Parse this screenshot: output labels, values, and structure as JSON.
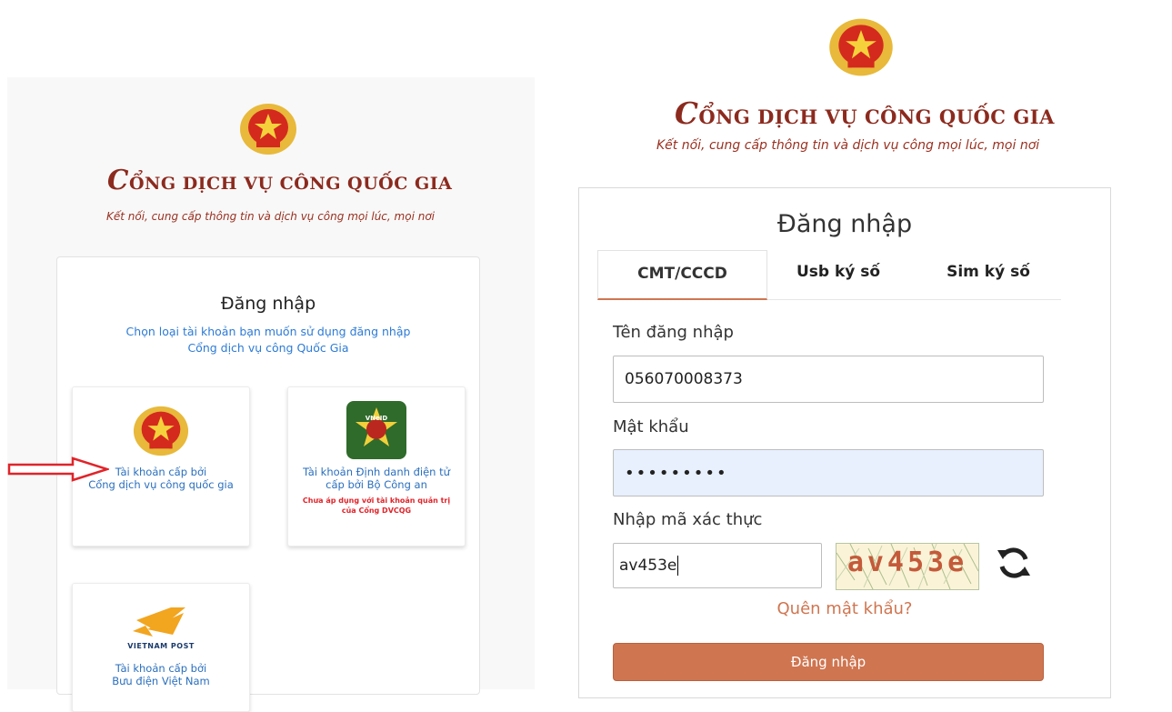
{
  "brand": {
    "title_rest": "ỔNG DỊCH VỤ CÔNG QUỐC GIA",
    "title_initial": "C",
    "tagline": "Kết nối, cung cấp thông tin và dịch vụ công mọi lúc, mọi nơi"
  },
  "left": {
    "card_title": "Đăng nhập",
    "card_sub_line1": "Chọn loại tài khoản bạn muốn sử dụng đăng nhập",
    "card_sub_line2": "Cổng dịch vụ công Quốc Gia",
    "options": [
      {
        "line1": "Tài khoản cấp bởi",
        "line2": "Cổng dịch vụ công quốc gia",
        "icon": "national-emblem-icon"
      },
      {
        "line1": "Tài khoản Định danh điện tử",
        "line2": "cấp bởi Bộ Công an",
        "warn1": "Chưa áp dụng với tài khoản quản trị",
        "warn2": "của Cổng DVCQG",
        "badge_text": "VNeID",
        "icon": "vneid-logo-icon"
      },
      {
        "line1": "Tài khoản cấp bởi",
        "line2": "Bưu điện Việt Nam",
        "logo_text": "VIETNAM POST",
        "icon": "vietnam-post-logo-icon"
      }
    ]
  },
  "login": {
    "title": "Đăng nhập",
    "tabs": [
      "CMT/CCCD",
      "Usb ký số",
      "Sim ký số"
    ],
    "username_label": "Tên đăng nhập",
    "username_value": "056070008373",
    "password_label": "Mật khẩu",
    "password_value": "•••••••••",
    "captcha_label": "Nhập mã xác thực",
    "captcha_input": "av453e",
    "captcha_image_text": "av453e",
    "forgot": "Quên mật khẩu?",
    "submit": "Đăng nhập"
  },
  "colors": {
    "brand_red": "#8c2a1e",
    "accent": "#cf7550",
    "link_blue": "#2d7bd6",
    "arrow_red": "#e0242a"
  }
}
